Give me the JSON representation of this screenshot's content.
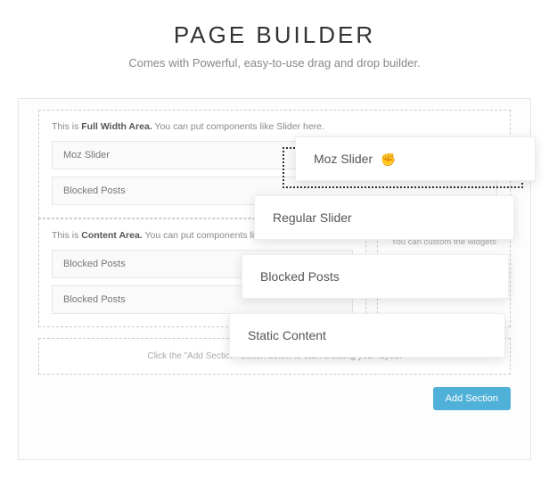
{
  "heading": "PAGE BUILDER",
  "subheading": "Comes with Powerful, easy-to-use drag and drop builder.",
  "fullwidth_area": {
    "label_pre": "This is ",
    "label_bold": "Full Width Area.",
    "label_post": " You can put components like Slider here.",
    "rows": [
      "Moz Slider",
      "Blocked Posts"
    ]
  },
  "content_area": {
    "label_pre": "This is ",
    "label_bold": "Content Area.",
    "label_post": " You can put components like Blocked Post...",
    "rows": [
      "Blocked Posts",
      "Blocked Posts"
    ]
  },
  "sidebar_note": "You can custom the widgets",
  "empty_hint": "Click the \"Add Section\" button below to start creating your layout",
  "add_button": "Add Section",
  "picker": {
    "opt1": "Moz Slider",
    "opt2": "Regular Slider",
    "opt3": "Blocked Posts",
    "opt4": "Static Content"
  }
}
